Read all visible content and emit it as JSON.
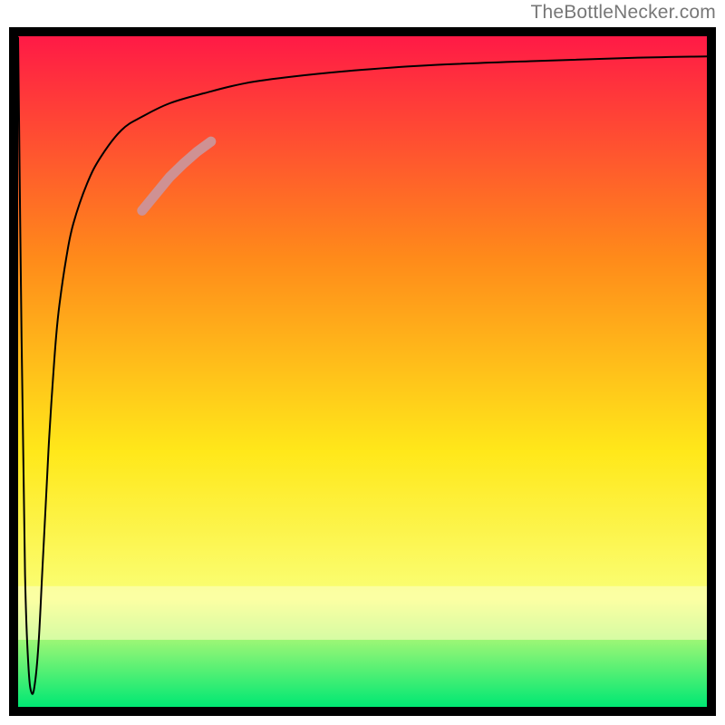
{
  "watermark": "TheBottleNecker.com",
  "chart_data": {
    "type": "line",
    "title": "",
    "xlabel": "",
    "ylabel": "",
    "xlim": [
      0,
      100
    ],
    "ylim": [
      0,
      100
    ],
    "background_gradient": {
      "top": "#ff1a46",
      "upper_mid": "#ff8a1a",
      "mid": "#ffe81a",
      "lower_mid": "#faff77",
      "bottom": "#00e873"
    },
    "series": [
      {
        "name": "curve",
        "x": [
          0,
          0.5,
          1,
          1.5,
          2,
          2.5,
          3,
          3.5,
          4,
          4.5,
          5,
          5.5,
          6,
          7,
          8,
          10,
          12,
          15,
          18,
          22,
          27,
          33,
          40,
          50,
          60,
          75,
          90,
          100
        ],
        "y": [
          99.8,
          55,
          20,
          6,
          2,
          4,
          10,
          20,
          30,
          40,
          48,
          55,
          60,
          67,
          72,
          78,
          82,
          86,
          88,
          90,
          91.5,
          93,
          94,
          95,
          95.7,
          96.3,
          96.8,
          97
        ],
        "color": "#000000",
        "stroke_width": 2
      },
      {
        "name": "highlight-segment",
        "x": [
          18,
          20,
          22,
          24,
          26,
          28
        ],
        "y": [
          74,
          76.5,
          79,
          81,
          82.8,
          84.3
        ],
        "color": "#cf9193",
        "stroke_width": 11
      }
    ],
    "frame_color": "#000000"
  }
}
